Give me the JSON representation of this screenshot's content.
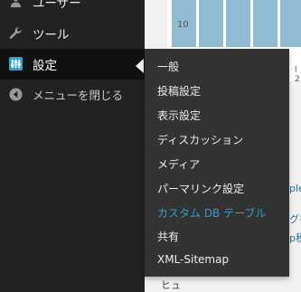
{
  "admin_menu": {
    "items": [
      {
        "label": "ユーザー",
        "icon": "users-icon"
      },
      {
        "label": "ツール",
        "icon": "wrench-icon"
      },
      {
        "label": "設定",
        "icon": "settings-sliders-icon"
      },
      {
        "label": "メニューを閉じる",
        "icon": "collapse-arrow-icon"
      }
    ]
  },
  "settings_submenu": [
    {
      "label": "一般"
    },
    {
      "label": "投稿設定"
    },
    {
      "label": "表示設定"
    },
    {
      "label": "ディスカッション"
    },
    {
      "label": "メディア"
    },
    {
      "label": "パーマリンク設定"
    },
    {
      "label": "カスタム DB テーブル",
      "current": true
    },
    {
      "label": "共有"
    },
    {
      "label": "XML-Sitemap"
    }
  ],
  "background": {
    "chart_axis_label": "10",
    "tick_label": "l 2",
    "peek_texts": [
      "ple",
      "グを",
      "p税"
    ],
    "bottom_label": "ヒュ"
  },
  "colors": {
    "sidebar_bg": "#222222",
    "flyout_bg": "#333333",
    "current_link": "#2ea2cc",
    "chart_bar": "#91bbd3"
  }
}
